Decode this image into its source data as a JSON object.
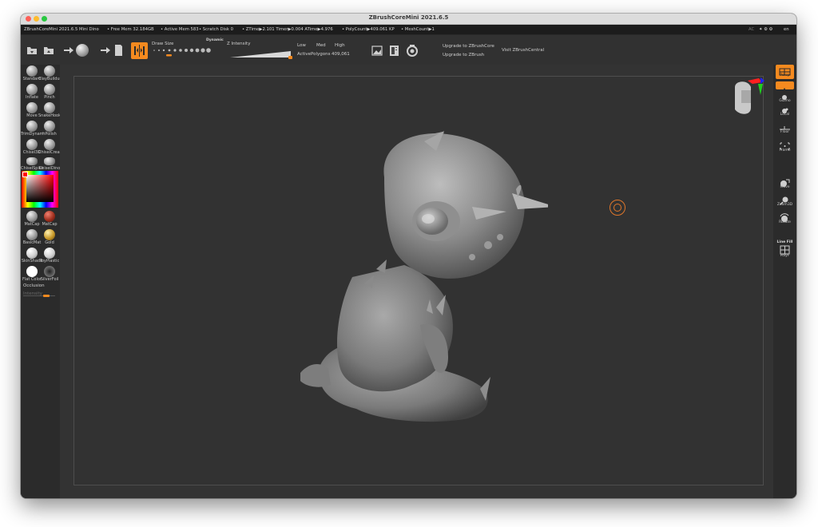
{
  "window": {
    "title": "ZBrushCoreMini 2021.6.5"
  },
  "statusbar": {
    "app_version": "ZBrushCoreMini 2021.6.5 Mini Dino",
    "free_mem": "• Free Mem 32.184GB",
    "active_mem": "• Active Mem 583",
    "scratch_disk": "• Scratch Disk 0",
    "ztime": "• ZTime▶2.101 Timer▶0.004 ATime▶4.976",
    "polycount": "• PolyCount▶409.061 KP",
    "meshcount": "• MeshCount▶1",
    "right_ac": "AC",
    "right_en": "en"
  },
  "toolbar": {
    "draw_size_label": "Draw Size",
    "dynamic_label": "Dynamic",
    "z_intensity_label": "Z Intensity",
    "low_label": "Low",
    "med_label": "Med",
    "high_label": "High",
    "active_polygons_label": "ActivePolygons",
    "active_polygons_value": "409,061",
    "upgrade_core": "Upgrade to ZBrushCore",
    "upgrade_zbrush": "Upgrade to ZBrush",
    "visit_central": "Visit ZBrushCentral"
  },
  "left_panel": {
    "brushes": [
      {
        "label": "Standard"
      },
      {
        "label": "ClayBuildup"
      },
      {
        "label": "Inflate"
      },
      {
        "label": "Pinch"
      },
      {
        "label": "Move"
      },
      {
        "label": "SnakeHook"
      },
      {
        "label": "TrimDynamic"
      },
      {
        "label": "hPolish"
      },
      {
        "label": "Chisel3D"
      },
      {
        "label": "ChiselCreature"
      },
      {
        "label": "ChiselSpike"
      },
      {
        "label": "ChiselDino"
      }
    ],
    "materials": [
      {
        "label": "MatCap"
      },
      {
        "label": "MatCap"
      },
      {
        "label": "BasicMat"
      },
      {
        "label": "Gold"
      },
      {
        "label": "SkinShade"
      },
      {
        "label": "ToyPlastic"
      },
      {
        "label": "Flat Color"
      },
      {
        "label": "SilverFoil"
      }
    ],
    "occlusion_label": "Occlusion",
    "intensity_label": "Intensity",
    "colors": {
      "picker_red": "#ff0000",
      "active_orange": "#f58a1f"
    }
  },
  "right_panel": {
    "items": [
      {
        "label": "Persp"
      },
      {
        "label": "Floor"
      },
      {
        "label": "Gizmo"
      },
      {
        "label": "Local"
      },
      {
        "label": "Floor"
      },
      {
        "label": "Frame"
      },
      {
        "label": "Move"
      },
      {
        "label": "Zoom3D"
      },
      {
        "label": "Rotate"
      },
      {
        "label": "Line Fill"
      },
      {
        "label": "PolyF"
      }
    ]
  },
  "colors": {
    "accent": "#f58a1f",
    "canvas_bg": "#323232",
    "panel_bg": "#2b2b2b"
  }
}
